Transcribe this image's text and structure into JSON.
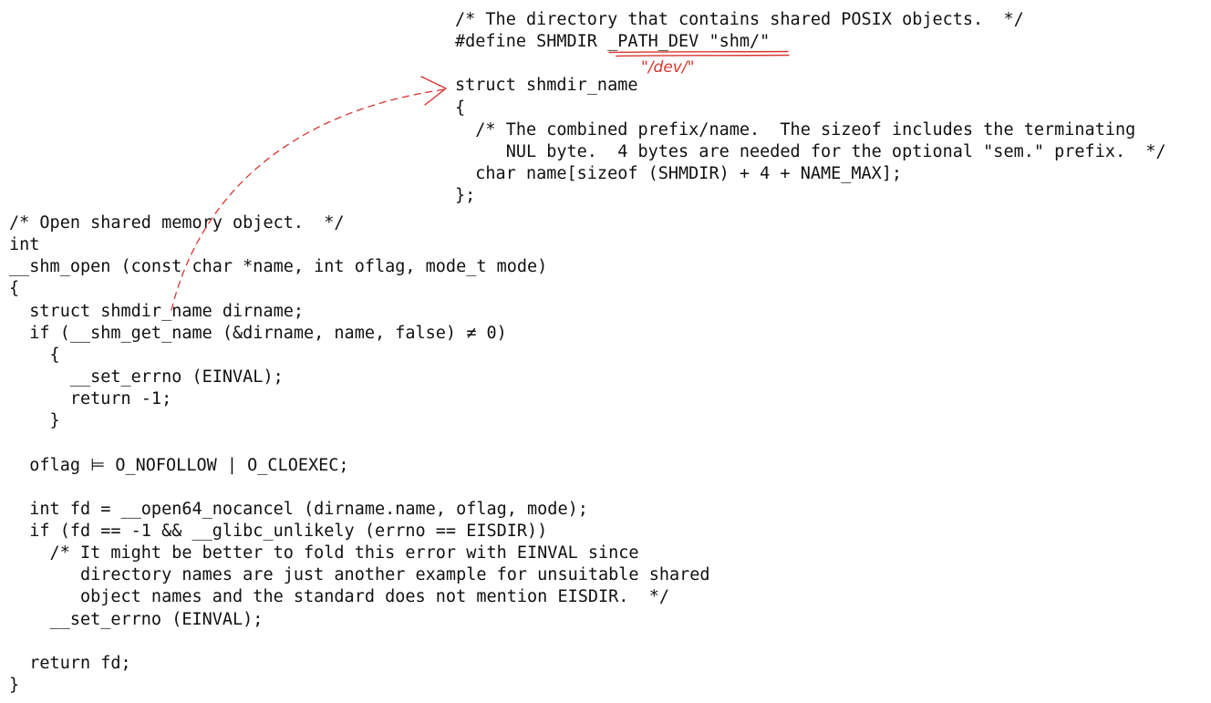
{
  "annotation": {
    "color": "#d9352f",
    "note": "\"/dev/\""
  },
  "top_code": {
    "lines": [
      "/* The directory that contains shared POSIX objects.  */",
      "#define SHMDIR ",
      "",
      "struct shmdir_name",
      "{",
      "  /* The combined prefix/name.  The sizeof includes the terminating",
      "     NUL byte.  4 bytes are needed for the optional \"sem.\" prefix.  */",
      "  char name[sizeof (SHMDIR) + 4 + NAME_MAX];",
      "};"
    ],
    "define_value": "_PATH_DEV \"shm/\""
  },
  "main_code": {
    "lines": [
      "/* Open shared memory object.  */",
      "int",
      "__shm_open (const char *name, int oflag, mode_t mode)",
      "{",
      "  struct shmdir_name dirname;",
      "  if (__shm_get_name (&dirname, name, false) ≠ 0)",
      "    {",
      "      __set_errno (EINVAL);",
      "      return -1;",
      "    }",
      "",
      "  oflag ⊨ O_NOFOLLOW | O_CLOEXEC;",
      "",
      "  int fd = __open64_nocancel (dirname.name, oflag, mode);",
      "  if (fd == -1 && __glibc_unlikely (errno == EISDIR))",
      "    /* It might be better to fold this error with EINVAL since",
      "       directory names are just another example for unsuitable shared",
      "       object names and the standard does not mention EISDIR.  */",
      "    __set_errno (EINVAL);",
      "",
      "  return fd;",
      "}"
    ]
  }
}
